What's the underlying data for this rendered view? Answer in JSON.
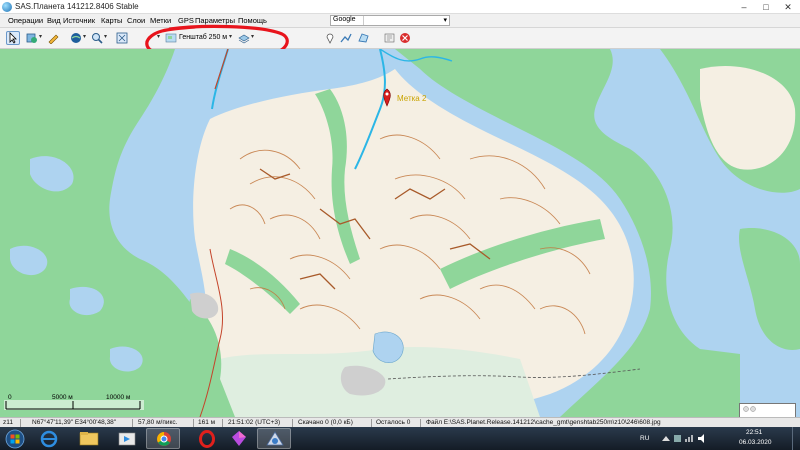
{
  "window": {
    "title": "SAS.Планета 141212.8406 Stable",
    "min_glyph": "–",
    "max_glyph": "□",
    "close_glyph": "✕"
  },
  "menu": {
    "items": [
      "Операции",
      "Вид",
      "Источник",
      "Карты",
      "Слои",
      "Метки",
      "GPS",
      "Параметры",
      "Помощь"
    ],
    "search_provider": "Google"
  },
  "toolbar": {
    "map_layer_label": "Генштаб 250 м",
    "annotation_color": "#e8141c"
  },
  "map": {
    "marker_label": "Метка 2",
    "scale_labels": [
      "0",
      "5000 м",
      "10000 м"
    ],
    "colors": {
      "water": "#aed3f0",
      "forest": "#8fd69a",
      "land": "#f5efe3",
      "contour": "#c2773e",
      "river": "#2bb6e6",
      "road": "#c4442a",
      "marker": "#d81e1e",
      "marker_text": "#c9a300"
    }
  },
  "statusbar": {
    "zoom": "z11",
    "coords": "N67°47'11,39\" E34°00'48,38\"",
    "resolution": "57,80 м/пикс.",
    "elevation": "161 м",
    "time": "21:51:02 (UTC+3)",
    "downloaded": "Скачано 0 (0,0 кБ)",
    "remaining": "Осталось 0",
    "file": "Файл E:\\SAS.Planet.Release.141212\\cache_gmt\\genshtab250m\\z10\\246\\608.jpg"
  },
  "taskbar": {
    "language": "RU",
    "time": "22:51",
    "date": "06.03.2020"
  }
}
